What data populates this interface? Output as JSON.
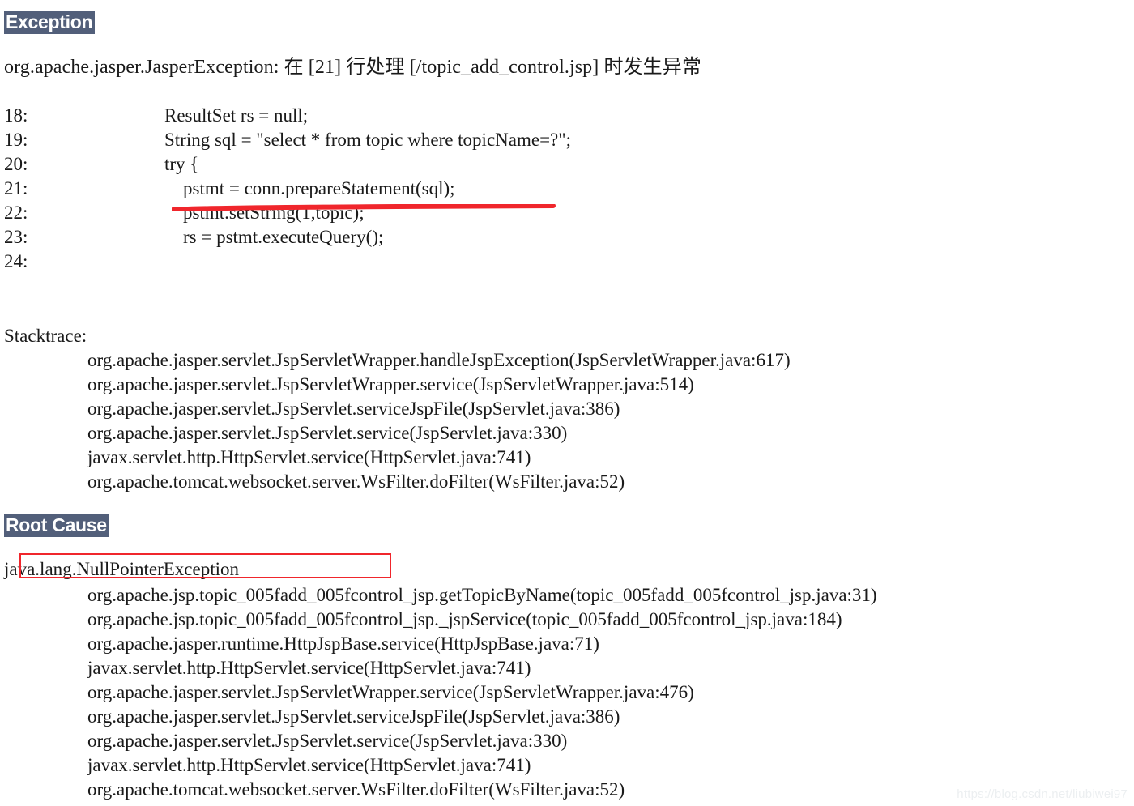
{
  "page": {
    "background_color": "#ffffff",
    "text_color": "#1a1a1a",
    "header_background_color": "#525f7a",
    "header_text_color": "#ffffff",
    "annotation_color": "#f0262c",
    "watermark_color": "#eceff1"
  },
  "exception_section": {
    "header": "Exception",
    "message": "org.apache.jasper.JasperException: 在 [21] 行处理 [/topic_add_control.jsp] 时发生异常",
    "code_lines": [
      {
        "number": "18:",
        "code": "        ResultSet rs = null;"
      },
      {
        "number": "19:",
        "code": "        String sql = \"select * from topic where topicName=?\";"
      },
      {
        "number": "20:",
        "code": "        try {"
      },
      {
        "number": "21:",
        "code": "            pstmt = conn.prepareStatement(sql);"
      },
      {
        "number": "22:",
        "code": "            pstmt.setString(1,topic);"
      },
      {
        "number": "23:",
        "code": "            rs = pstmt.executeQuery();"
      },
      {
        "number": "24:",
        "code": ""
      }
    ],
    "stacktrace_title": "Stacktrace:",
    "stacktrace_lines": [
      "org.apache.jasper.servlet.JspServletWrapper.handleJspException(JspServletWrapper.java:617)",
      "org.apache.jasper.servlet.JspServletWrapper.service(JspServletWrapper.java:514)",
      "org.apache.jasper.servlet.JspServlet.serviceJspFile(JspServlet.java:386)",
      "org.apache.jasper.servlet.JspServlet.service(JspServlet.java:330)",
      "javax.servlet.http.HttpServlet.service(HttpServlet.java:741)",
      "org.apache.tomcat.websocket.server.WsFilter.doFilter(WsFilter.java:52)"
    ]
  },
  "root_cause_section": {
    "header": "Root Cause",
    "exception_name": "java.lang.NullPointerException",
    "stacktrace_lines": [
      "org.apache.jsp.topic_005fadd_005fcontrol_jsp.getTopicByName(topic_005fadd_005fcontrol_jsp.java:31)",
      "org.apache.jsp.topic_005fadd_005fcontrol_jsp._jspService(topic_005fadd_005fcontrol_jsp.java:184)",
      "org.apache.jasper.runtime.HttpJspBase.service(HttpJspBase.java:71)",
      "javax.servlet.http.HttpServlet.service(HttpServlet.java:741)",
      "org.apache.jasper.servlet.JspServletWrapper.service(JspServletWrapper.java:476)",
      "org.apache.jasper.servlet.JspServlet.serviceJspFile(JspServlet.java:386)",
      "org.apache.jasper.servlet.JspServlet.service(JspServlet.java:330)",
      "javax.servlet.http.HttpServlet.service(HttpServlet.java:741)",
      "org.apache.tomcat.websocket.server.WsFilter.doFilter(WsFilter.java:52)"
    ]
  },
  "annotations": {
    "underline_target": "pstmt = conn.prepareStatement(sql);",
    "box_target": "java.lang.NullPointerException"
  },
  "watermark": {
    "text": "https://blog.csdn.net/liubiwei97"
  }
}
